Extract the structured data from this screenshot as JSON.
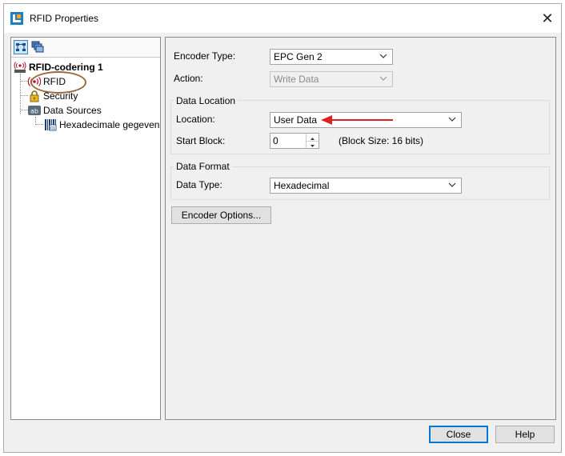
{
  "window": {
    "title": "RFID Properties"
  },
  "tree": {
    "root": {
      "label": "RFID-codering 1"
    },
    "items": [
      {
        "label": "RFID"
      },
      {
        "label": "Security"
      },
      {
        "label": "Data Sources"
      }
    ],
    "data_source_child": {
      "label": "Hexadecimale gegeven"
    }
  },
  "form": {
    "encoder_type": {
      "label": "Encoder Type:",
      "value": "EPC Gen 2"
    },
    "action": {
      "label": "Action:",
      "value": "Write Data"
    },
    "data_location": {
      "title": "Data Location",
      "location": {
        "label": "Location:",
        "value": "User Data"
      },
      "start_block": {
        "label": "Start Block:",
        "value": "0"
      },
      "block_size": "(Block Size:  16 bits)"
    },
    "data_format": {
      "title": "Data Format",
      "data_type": {
        "label": "Data Type:",
        "value": "Hexadecimal"
      }
    },
    "encoder_options_label": "Encoder Options..."
  },
  "footer": {
    "close_label": "Close",
    "help_label": "Help"
  },
  "colors": {
    "annotation_arrow": "#e02020",
    "annotation_circle": "#9b6a3c",
    "default_button_border": "#0078d7"
  }
}
